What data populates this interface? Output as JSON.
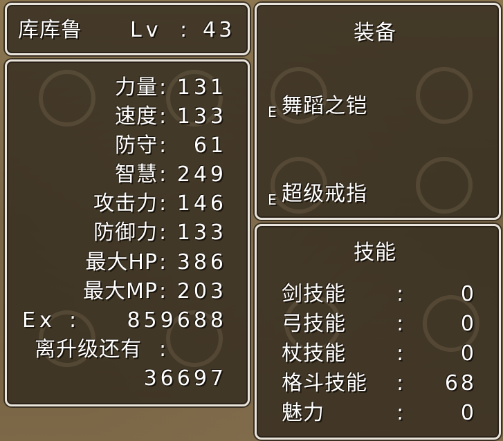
{
  "character": {
    "name": "库库鲁",
    "level_label": "Lv",
    "level_sep": ":",
    "level": "43"
  },
  "stats": [
    {
      "label": "力量",
      "sep": ":",
      "value": "131"
    },
    {
      "label": "速度",
      "sep": ":",
      "value": "133"
    },
    {
      "label": "防守",
      "sep": ":",
      "value": "61"
    },
    {
      "label": "智慧",
      "sep": ":",
      "value": "249"
    },
    {
      "label": "攻击力",
      "sep": ":",
      "value": "146"
    },
    {
      "label": "防御力",
      "sep": ":",
      "value": "133"
    },
    {
      "label": "最大HP",
      "sep": ":",
      "value": "386"
    },
    {
      "label": "最大MP",
      "sep": ":",
      "value": "203"
    }
  ],
  "exp": {
    "label": "Ex",
    "sep": ":",
    "value": "859688"
  },
  "next_level": {
    "label": "离升级还有",
    "sep": ":",
    "value": "36697"
  },
  "equipment": {
    "title": "装备",
    "items": [
      {
        "marker": "E",
        "name": "舞蹈之铠"
      },
      {
        "marker": "E",
        "name": "超级戒指"
      }
    ]
  },
  "skills": {
    "title": "技能",
    "items": [
      {
        "name": "剑技能",
        "sep": ":",
        "value": "0"
      },
      {
        "name": "弓技能",
        "sep": ":",
        "value": "0"
      },
      {
        "name": "杖技能",
        "sep": ":",
        "value": "0"
      },
      {
        "name": "格斗技能",
        "sep": ":",
        "value": "68"
      },
      {
        "name": "魅力",
        "sep": ":",
        "value": "0"
      }
    ]
  }
}
